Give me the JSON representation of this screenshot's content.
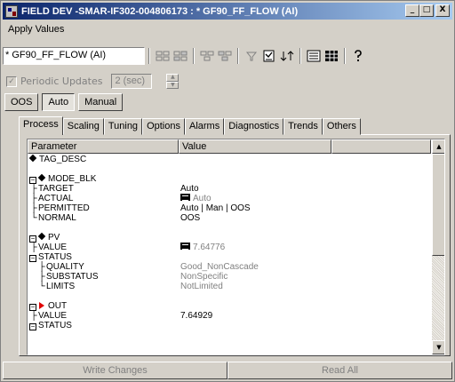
{
  "window": {
    "title": "FIELD DEV -SMAR-IF302-004806173 : * GF90_FF_FLOW (AI)",
    "minimize": "_",
    "maximize": "□",
    "close": "X"
  },
  "menu": {
    "items": [
      "Apply Values"
    ]
  },
  "toolbar": {
    "block_selector": "* GF90_FF_FLOW (AI)",
    "icons": [
      "upload-block-icon",
      "download-block-icon",
      "upload-param-icon",
      "download-param-icon",
      "filter-icon",
      "compare-icon",
      "sort-icon",
      "list-view-icon",
      "grid-view-icon",
      "help-icon"
    ]
  },
  "periodic": {
    "label": "Periodic Updates",
    "value": "2 (sec)",
    "checked": "✓"
  },
  "modes": {
    "oos": "OOS",
    "auto": "Auto",
    "manual": "Manual"
  },
  "tabs": [
    "Process",
    "Scaling",
    "Tuning",
    "Options",
    "Alarms",
    "Diagnostics",
    "Trends",
    "Others"
  ],
  "list": {
    "col_parameter": "Parameter",
    "col_value": "Value",
    "rows": [
      {
        "name": "TAG_DESC",
        "value": ""
      },
      {
        "name": "MODE_BLK",
        "value": ""
      },
      {
        "name": "TARGET",
        "value": "Auto"
      },
      {
        "name": "ACTUAL",
        "value": "Auto"
      },
      {
        "name": "PERMITTED",
        "value": "Auto | Man | OOS"
      },
      {
        "name": "NORMAL",
        "value": "OOS"
      },
      {
        "name": "PV",
        "value": ""
      },
      {
        "name": "VALUE",
        "value": "7.64776"
      },
      {
        "name": "STATUS",
        "value": ""
      },
      {
        "name": "QUALITY",
        "value": "Good_NonCascade"
      },
      {
        "name": "SUBSTATUS",
        "value": "NonSpecific"
      },
      {
        "name": "LIMITS",
        "value": "NotLimited"
      },
      {
        "name": "OUT",
        "value": ""
      },
      {
        "name": "VALUE",
        "value": "7.64929"
      },
      {
        "name": "STATUS",
        "value": ""
      }
    ]
  },
  "buttons": {
    "write": "Write Changes",
    "read": "Read All"
  },
  "colors": {
    "title_start": "#0a246a",
    "title_end": "#a6caf0",
    "face": "#d4d0c8",
    "out_arrow": "#e00000"
  }
}
